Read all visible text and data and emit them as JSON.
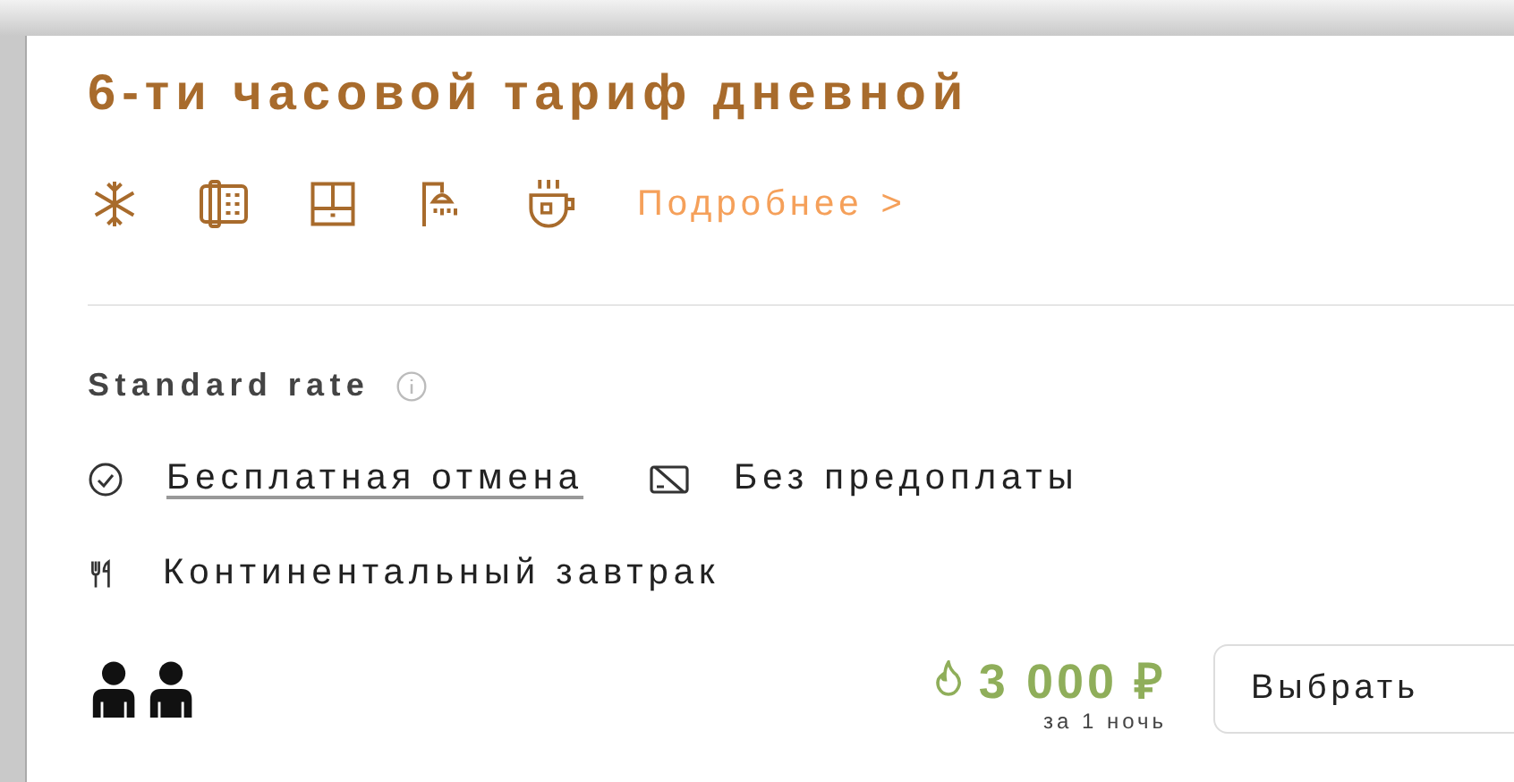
{
  "title": "6-ти часовой тариф дневной",
  "more_link": {
    "label": "Подробнее",
    "chevron": ">"
  },
  "rate": {
    "name": "Standard rate"
  },
  "conditions": [
    {
      "kind": "cancel",
      "label": "Бесплатная отмена",
      "link": true
    },
    {
      "kind": "no-prepay",
      "label": "Без предоплаты",
      "link": false
    }
  ],
  "meal": {
    "kind": "breakfast",
    "label": "Континентальный завтрак"
  },
  "price": {
    "amount": "3 000 ₽",
    "note": "за 1 ночь"
  },
  "select_button": {
    "label": "Выбрать"
  }
}
